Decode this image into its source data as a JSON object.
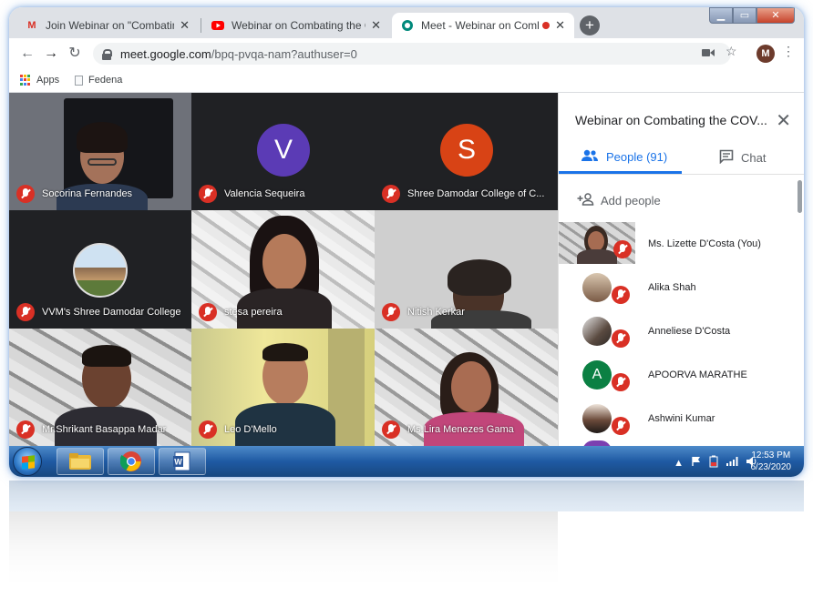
{
  "browser": {
    "tabs": [
      {
        "label": "Join Webinar on \"Combating the",
        "icon": "gmail-icon",
        "active": false
      },
      {
        "label": "Webinar on Combating the COV",
        "icon": "youtube-icon",
        "active": false
      },
      {
        "label": "Meet - Webinar on Combatin",
        "icon": "meet-icon",
        "active": true
      }
    ],
    "tab_close": "✕",
    "new_tab": "+",
    "url_host": "meet.google.com",
    "url_path": "/bpq-pvqa-nam?authuser=0",
    "profile_initial": "M",
    "bookmarks": [
      {
        "label": "Apps",
        "icon": "apps-grid-icon"
      },
      {
        "label": "Fedena",
        "icon": "document-icon"
      }
    ]
  },
  "meet": {
    "tiles": [
      {
        "name": "Socorina Fernandes",
        "type": "video"
      },
      {
        "name": "Valencia Sequeira",
        "type": "letter",
        "letter": "V",
        "color": "#5b3bb5"
      },
      {
        "name": "Shree Damodar College of C...",
        "type": "letter",
        "letter": "S",
        "color": "#d84315"
      },
      {
        "name": "VVM's Shree Damodar College",
        "type": "logo"
      },
      {
        "name": "stesa pereira",
        "type": "video"
      },
      {
        "name": "Nitish Kerkar",
        "type": "video"
      },
      {
        "name": "Mr.Shrikant Basappa Madar",
        "type": "video"
      },
      {
        "name": "Leo D'Mello",
        "type": "video"
      },
      {
        "name": "Ms.Lira Menezes Gama",
        "type": "video"
      }
    ],
    "panel": {
      "title": "Webinar on Combating the COV...",
      "tab_people": "People (91)",
      "tab_chat": "Chat",
      "add_people": "Add people",
      "people": [
        {
          "name": "Ms. Lizette D'Costa (You)",
          "type": "photo"
        },
        {
          "name": "Alika Shah",
          "type": "photo"
        },
        {
          "name": "Anneliese D'Costa",
          "type": "photo"
        },
        {
          "name": "APOORVA MARATHE",
          "type": "letter",
          "letter": "A",
          "color": "#0b8043"
        },
        {
          "name": "Ashwini Kumar",
          "type": "photo"
        }
      ]
    }
  },
  "taskbar": {
    "time": "12:53 PM",
    "date": "6/23/2020"
  },
  "colors": {
    "accent": "#1a73e8",
    "mic_off": "#d93025",
    "grid_bg": "#202124"
  }
}
